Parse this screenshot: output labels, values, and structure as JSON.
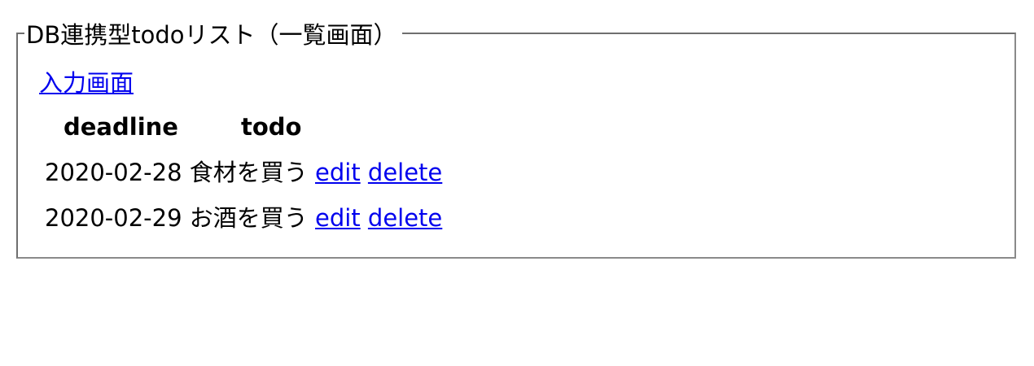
{
  "panel": {
    "legend": "DB連携型todoリスト（一覧画面）",
    "nav_link": "入力画面"
  },
  "table": {
    "headers": [
      "deadline",
      "todo"
    ],
    "rows": [
      {
        "deadline": "2020-02-28",
        "todo": "食材を買う",
        "edit_label": "edit",
        "delete_label": "delete"
      },
      {
        "deadline": "2020-02-29",
        "todo": "お酒を買う",
        "edit_label": "edit",
        "delete_label": "delete"
      }
    ]
  },
  "colors": {
    "link": "#0000ee",
    "border": "#8a8a8a"
  }
}
